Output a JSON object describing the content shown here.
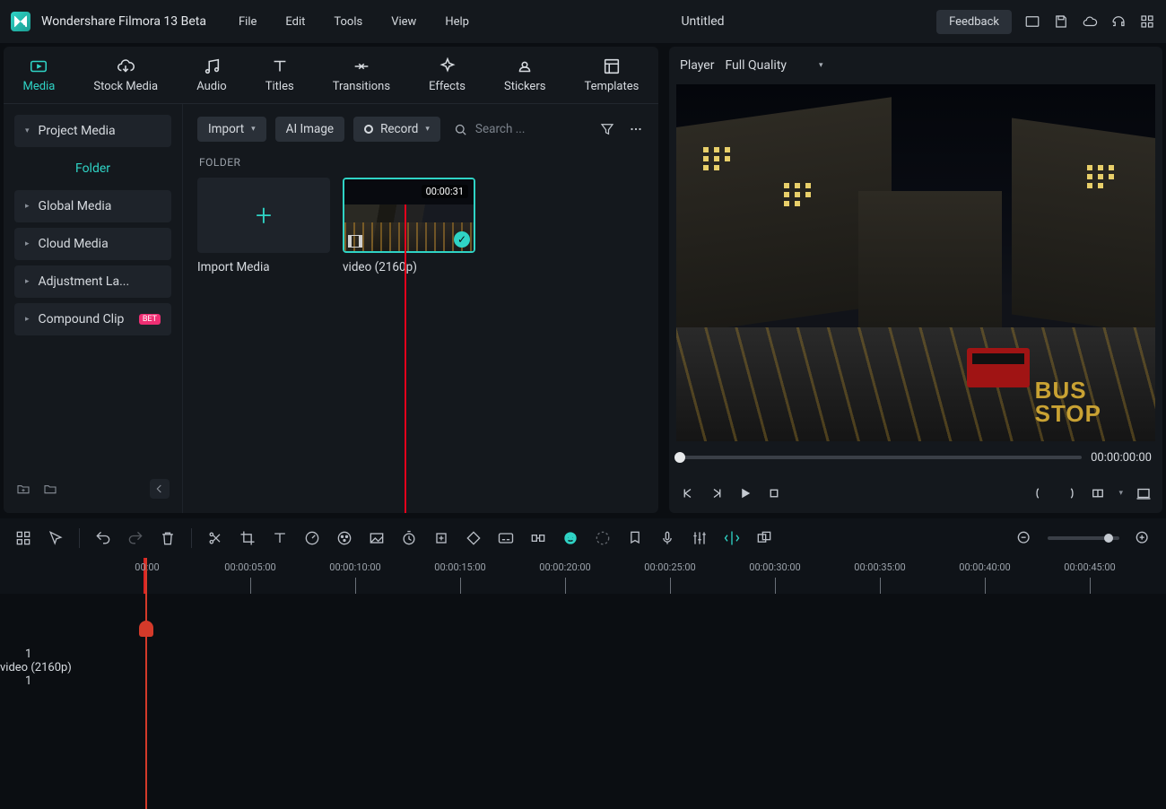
{
  "titlebar": {
    "app_title": "Wondershare Filmora 13 Beta",
    "menu": [
      "File",
      "Edit",
      "Tools",
      "View",
      "Help"
    ],
    "doc_title": "Untitled",
    "feedback": "Feedback"
  },
  "tabs": [
    {
      "id": "media",
      "label": "Media",
      "active": true
    },
    {
      "id": "stock",
      "label": "Stock Media"
    },
    {
      "id": "audio",
      "label": "Audio"
    },
    {
      "id": "titles",
      "label": "Titles"
    },
    {
      "id": "transitions",
      "label": "Transitions"
    },
    {
      "id": "effects",
      "label": "Effects"
    },
    {
      "id": "stickers",
      "label": "Stickers"
    },
    {
      "id": "templates",
      "label": "Templates"
    }
  ],
  "sidebar": {
    "items": [
      {
        "label": "Project Media",
        "expandable": true,
        "active": true
      },
      {
        "label": "Folder",
        "folder": true
      },
      {
        "label": "Global Media",
        "expandable": true
      },
      {
        "label": "Cloud Media",
        "expandable": true
      },
      {
        "label": "Adjustment La...",
        "expandable": true
      },
      {
        "label": "Compound Clip",
        "expandable": true,
        "beta": true
      }
    ],
    "beta_badge": "BET"
  },
  "content_toolbar": {
    "import": "Import",
    "ai_image": "AI Image",
    "record": "Record",
    "search_placeholder": "Search ..."
  },
  "folder_label": "FOLDER",
  "import_tile": "Import Media",
  "video_tile": {
    "duration": "00:00:31",
    "caption": "video (2160p)"
  },
  "player": {
    "label": "Player",
    "quality": "Full Quality",
    "timecode": "00:00:00:00",
    "bus_text": "BUS\nSTOP"
  },
  "ruler": {
    "start": "00:00",
    "labels": [
      "00:00:05:00",
      "00:00:10:00",
      "00:00:15:00",
      "00:00:20:00",
      "00:00:25:00",
      "00:00:30:00",
      "00:00:35:00",
      "00:00:40:00",
      "00:00:45:00"
    ]
  },
  "tracks": {
    "video_num": "1",
    "audio_num": "1",
    "clip_label": "video (2160p)"
  }
}
